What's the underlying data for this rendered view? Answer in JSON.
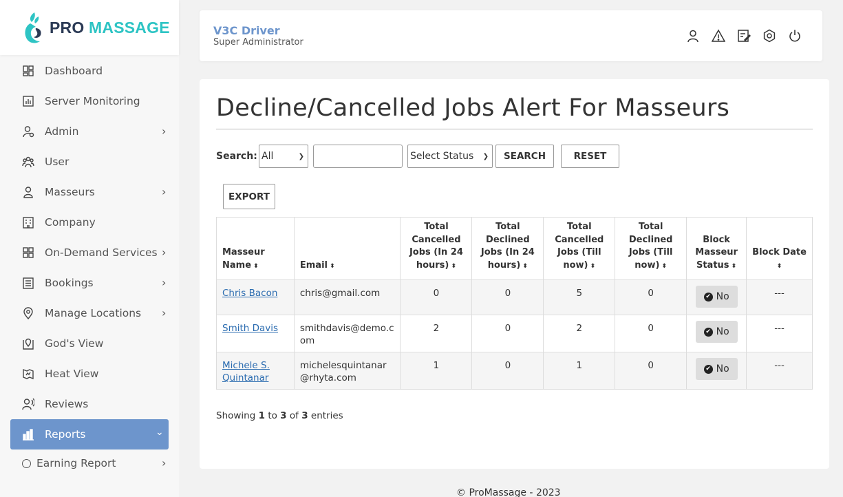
{
  "logo": {
    "pro": "PRO",
    "massage": "MASSAGE"
  },
  "sidebar": {
    "items": [
      {
        "label": "Dashboard",
        "icon": "dashboard-icon",
        "chevron": false
      },
      {
        "label": "Server Monitoring",
        "icon": "chart-icon",
        "chevron": false
      },
      {
        "label": "Admin",
        "icon": "admin-icon",
        "chevron": true
      },
      {
        "label": "User",
        "icon": "users-icon",
        "chevron": false
      },
      {
        "label": "Masseurs",
        "icon": "person-icon",
        "chevron": true
      },
      {
        "label": "Company",
        "icon": "building-icon",
        "chevron": false
      },
      {
        "label": "On-Demand Services",
        "icon": "grid-icon",
        "chevron": true
      },
      {
        "label": "Bookings",
        "icon": "list-icon",
        "chevron": true
      },
      {
        "label": "Manage Locations",
        "icon": "location-icon",
        "chevron": true
      },
      {
        "label": "God's View",
        "icon": "map-pin-icon",
        "chevron": false
      },
      {
        "label": "Heat View",
        "icon": "heat-map-icon",
        "chevron": false
      },
      {
        "label": "Reviews",
        "icon": "reviews-icon",
        "chevron": false
      },
      {
        "label": "Reports",
        "icon": "bar-chart-icon",
        "chevron": true,
        "active": true
      },
      {
        "label": "Earning Report",
        "icon": "circle-icon",
        "chevron": true,
        "sub": true
      }
    ]
  },
  "header": {
    "user_name": "V3C Driver",
    "user_role": "Super Administrator"
  },
  "page": {
    "title": "Decline/Cancelled Jobs Alert For Masseurs",
    "search_label": "Search:",
    "filter_select": "All",
    "status_select": "Select Status",
    "search_button": "SEARCH",
    "reset_button": "RESET",
    "export_button": "EXPORT"
  },
  "table": {
    "columns": [
      "Masseur Name",
      "Email",
      "Total Cancelled Jobs (In 24 hours)",
      "Total Declined Jobs (In 24 hours)",
      "Total Cancelled Jobs (Till now)",
      "Total Declined Jobs (Till now)",
      "Block Masseur Status",
      "Block Date"
    ],
    "rows": [
      {
        "name": "Chris Bacon",
        "email": "chris@gmail.com",
        "c24": "0",
        "d24": "0",
        "ct": "5",
        "dt": "0",
        "status": "No",
        "date": "---"
      },
      {
        "name": "Smith Davis",
        "email": "smithdavis@demo.com",
        "c24": "2",
        "d24": "0",
        "ct": "2",
        "dt": "0",
        "status": "No",
        "date": "---"
      },
      {
        "name": "Michele S. Quintanar",
        "email": "michelesquintanar@rhyta.com",
        "c24": "1",
        "d24": "0",
        "ct": "1",
        "dt": "0",
        "status": "No",
        "date": "---"
      }
    ]
  },
  "info": {
    "prefix": "Showing",
    "from": "1",
    "to_word": "to",
    "to": "3",
    "of_word": "of",
    "total": "3",
    "suffix": "entries"
  },
  "footer": "© ProMassage - 2023"
}
